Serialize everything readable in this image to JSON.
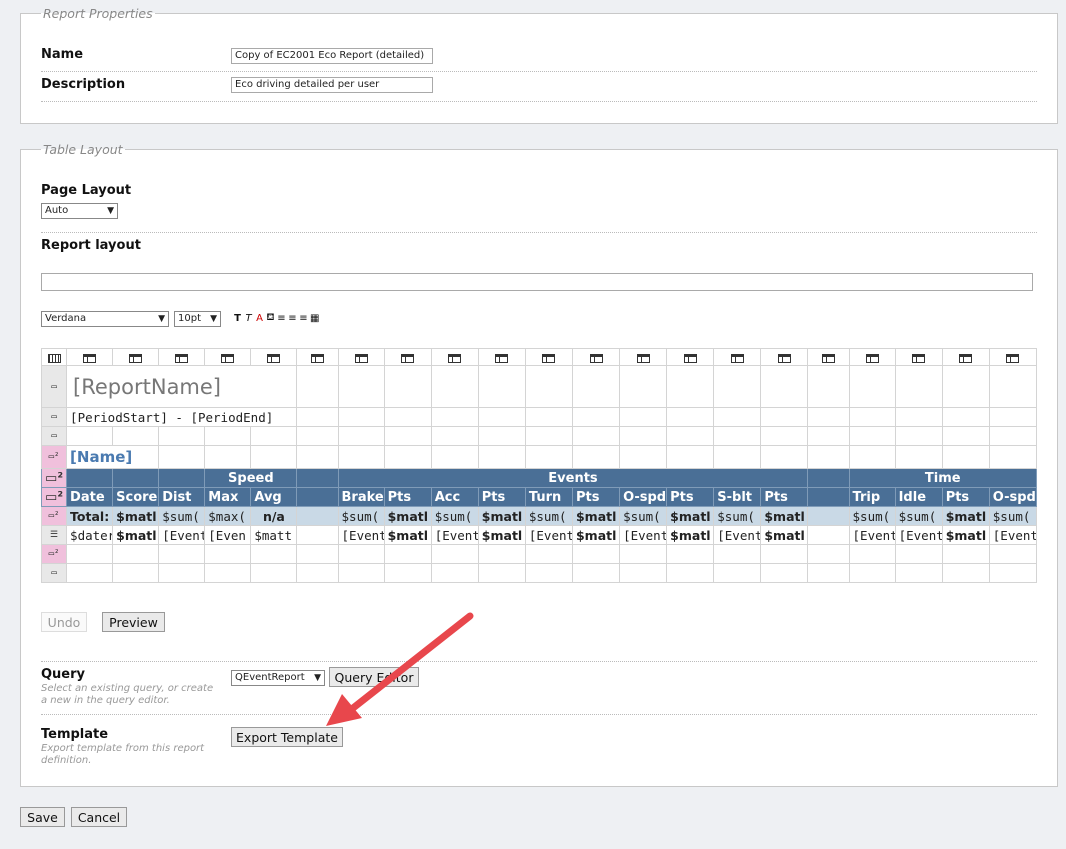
{
  "report_properties": {
    "legend": "Report Properties",
    "name_label": "Name",
    "name_value": "Copy of EC2001 Eco Report (detailed)",
    "description_label": "Description",
    "description_value": "Eco driving detailed per user"
  },
  "table_layout": {
    "legend": "Table Layout",
    "page_layout_label": "Page Layout",
    "page_layout_value": "Auto",
    "report_layout_label": "Report layout",
    "font_value": "Verdana",
    "size_value": "10pt",
    "grid": {
      "report_name": "[ReportName]",
      "period": "[PeriodStart] - [PeriodEnd]",
      "name": "[Name]",
      "group_headers": {
        "speed": "Speed",
        "events": "Events",
        "time": "Time"
      },
      "col_headers": [
        "Date",
        "Score",
        "Dist",
        "Max",
        "Avg",
        "",
        "Brake",
        "Pts",
        "Acc",
        "Pts",
        "Turn",
        "Pts",
        "O-spd",
        "Pts",
        "S-blt",
        "Pts",
        "",
        "Trip",
        "Idle",
        "Pts",
        "O-spd"
      ],
      "total_row": [
        "Total:",
        "$matl",
        "$sum(",
        "$max(",
        "n/a",
        "",
        "$sum(",
        "$matl",
        "$sum(",
        "$matl",
        "$sum(",
        "$matl",
        "$sum(",
        "$matl",
        "$sum(",
        "$matl",
        "",
        "$sum(",
        "$sum(",
        "$matl",
        "$sum("
      ],
      "detail_row": [
        "$dater",
        "$matl",
        "[Event",
        "[Even",
        "$matt",
        "",
        "[Event",
        "$matl",
        "[Event",
        "$matl",
        "[Event",
        "$matl",
        "[Event",
        "$matl",
        "[Event",
        "$matl",
        "",
        "[Event",
        "[Event",
        "$matl",
        "[Event"
      ]
    },
    "undo_label": "Undo",
    "preview_label": "Preview",
    "query_label": "Query",
    "query_help": "Select an existing query, or create a new in the query editor.",
    "query_value": "QEventReport",
    "query_editor_label": "Query Editor",
    "template_label": "Template",
    "template_help": "Export template from this report definition.",
    "export_template_label": "Export Template"
  },
  "footer": {
    "save_label": "Save",
    "cancel_label": "Cancel"
  },
  "colors": {
    "header_bg": "#4a6f96",
    "total_row_bg": "#c9d9e6",
    "row_marker_pink": "#f0c0dc",
    "annotation_arrow": "#e8474c"
  }
}
